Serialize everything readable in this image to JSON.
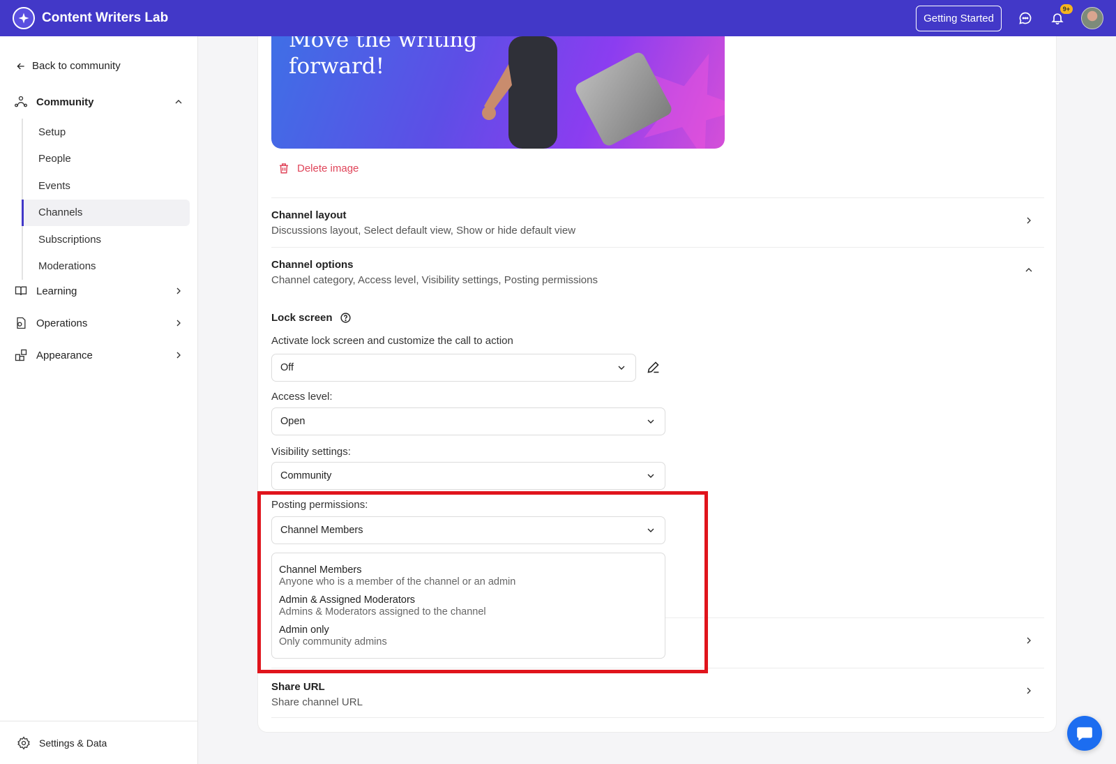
{
  "header": {
    "app_title": "Content Writers Lab",
    "getting_started": "Getting Started",
    "notif_badge": "9+"
  },
  "sidebar": {
    "back": "Back to community",
    "community": "Community",
    "sub_items": [
      "Setup",
      "People",
      "Events",
      "Channels",
      "Subscriptions",
      "Moderations"
    ],
    "active_item": "Channels",
    "learning": "Learning",
    "operations": "Operations",
    "appearance": "Appearance",
    "footer": "Settings & Data"
  },
  "hero": {
    "line1": "Move the writing",
    "line2": "forward!"
  },
  "delete_image": "Delete image",
  "channel_layout": {
    "title": "Channel layout",
    "desc": "Discussions layout, Select default view, Show or hide default view"
  },
  "channel_options": {
    "title": "Channel options",
    "desc": "Channel category, Access level, Visibility settings, Posting permissions"
  },
  "lock_screen": {
    "title": "Lock screen",
    "label": "Activate lock screen and customize the call to action",
    "value": "Off"
  },
  "access_level": {
    "label": "Access level:",
    "value": "Open"
  },
  "visibility": {
    "label": "Visibility settings:",
    "value": "Community"
  },
  "posting": {
    "label": "Posting permissions:",
    "value": "Channel Members",
    "options": [
      {
        "title": "Channel Members",
        "desc": "Anyone who is a member of the channel or an admin"
      },
      {
        "title": "Admin & Assigned Moderators",
        "desc": "Admins & Moderators assigned to the channel"
      },
      {
        "title": "Admin only",
        "desc": "Only community admins"
      }
    ]
  },
  "share_url": {
    "title": "Share URL",
    "desc": "Share channel URL"
  },
  "colors": {
    "brand": "#4238c8",
    "danger": "#e0455a",
    "highlight": "#e0141c",
    "chat": "#1c6df0"
  }
}
